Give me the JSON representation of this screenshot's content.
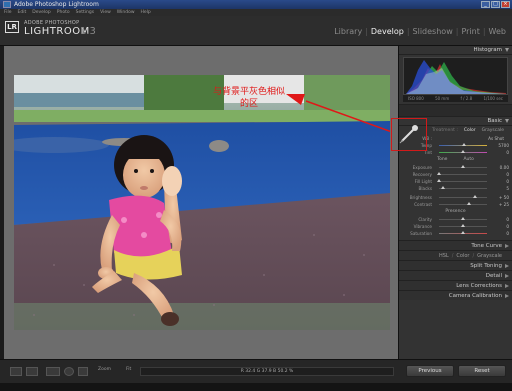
{
  "window": {
    "title": "Adobe Photoshop Lightroom",
    "menu": [
      "File",
      "Edit",
      "Develop",
      "Photo",
      "Settings",
      "View",
      "Window",
      "Help"
    ]
  },
  "identity": {
    "badge": "LR",
    "brand_small": "ADOBE PHOTOSHOP",
    "brand_big": "LIGHTROOM",
    "version": "1.3"
  },
  "modules": [
    "Library",
    "Develop",
    "Slideshow",
    "Print",
    "Web"
  ],
  "annotation": {
    "text": "与背景平灰色相似的区",
    "color": "#e01818"
  },
  "panel": {
    "histogram_label": "Histogram",
    "histogram_readout": [
      "ISO 800",
      "50 mm",
      "f / 2.8",
      "1/100 sec"
    ],
    "basic_label": "Basic",
    "treatment_label": "Treatment :",
    "treatment_color": "Color",
    "treatment_gray": "Grayscale",
    "wb_label": "WB :",
    "wb_value": "As Shot",
    "temp_label": "Temp",
    "temp_value": "5700",
    "tint_label": "Tint",
    "tint_value": "0",
    "tone_label": "Tone",
    "auto_label": "Auto",
    "exposure_label": "Exposure",
    "exposure_value": "0.00",
    "recovery_label": "Recovery",
    "recovery_value": "0",
    "fill_label": "Fill Light",
    "fill_value": "0",
    "blacks_label": "Blacks",
    "blacks_value": "5",
    "brightness_label": "Brightness",
    "brightness_value": "+ 50",
    "contrast_label": "Contrast",
    "contrast_value": "+ 25",
    "presence_label": "Presence",
    "clarity_label": "Clarity",
    "clarity_value": "0",
    "vibrance_label": "Vibrance",
    "vibrance_value": "0",
    "saturation_label": "Saturation",
    "saturation_value": "0",
    "tone_curve": "Tone Curve",
    "hsl": "HSL",
    "hsl_color": "Color",
    "hsl_gray": "Grayscale",
    "split_toning": "Split Toning",
    "detail": "Detail",
    "lens_corrections": "Lens Corrections",
    "camera_calibration": "Camera Calibration"
  },
  "bottom": {
    "zoom_label": "Zoom",
    "zoom_value": "Fit",
    "readout": "R  32.4   G  37.9   B  50.2  %",
    "previous": "Previous",
    "reset": "Reset"
  }
}
